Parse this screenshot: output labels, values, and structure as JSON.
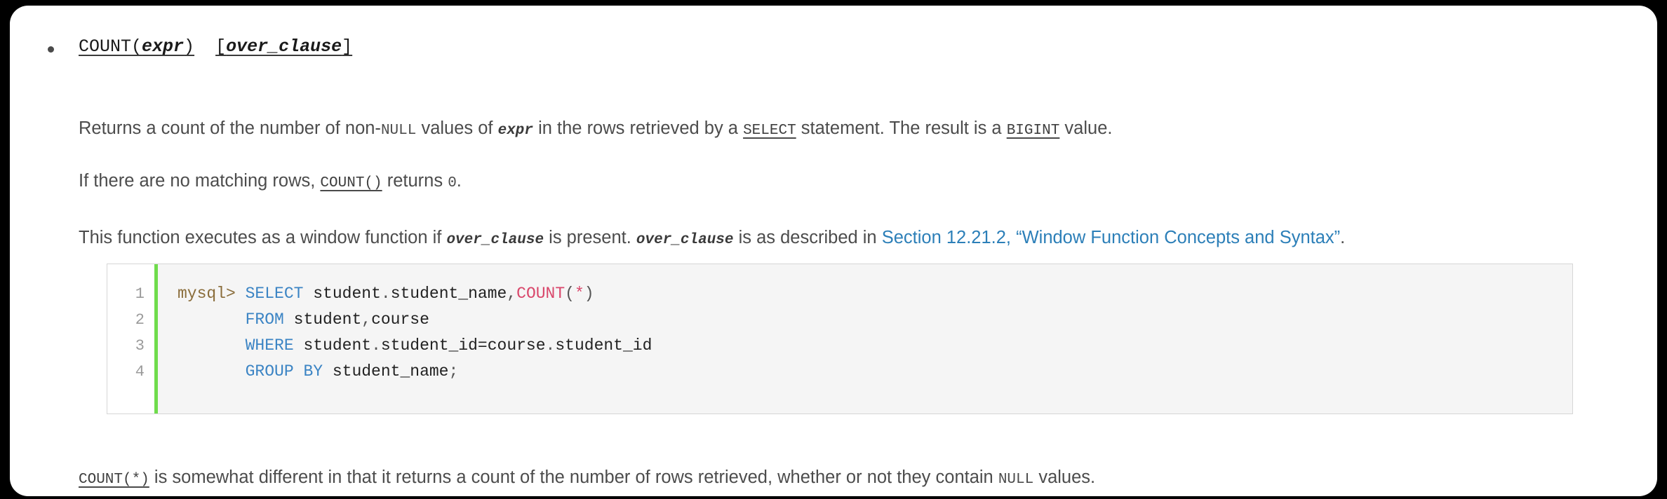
{
  "document": {
    "signature": {
      "fn_name": "COUNT",
      "open_paren": "(",
      "param": "expr",
      "close_paren": ")",
      "space": "  ",
      "bracket_open": "[",
      "over_clause": "over_clause",
      "bracket_close": "]"
    },
    "paragraph1": {
      "part1": "Returns a count of the number of non-",
      "null_kw": "NULL",
      "part2": " values of ",
      "expr": "expr",
      "part3": " in the rows retrieved by a ",
      "select_kw": "SELECT",
      "part4": " statement. The result is a ",
      "bigint_kw": "BIGINT",
      "part5": " value."
    },
    "paragraph2": {
      "part1": "If there are no matching rows, ",
      "count_kw": "COUNT()",
      "part2": " returns ",
      "zero": "0",
      "part3": "."
    },
    "paragraph3": {
      "part1": "This function executes as a window function if ",
      "over_clause_1": "over_clause",
      "part2": " is present. ",
      "over_clause_2": "over_clause",
      "part3": " is as described in ",
      "link": "Section 12.21.2, “Window Function Concepts and Syntax”",
      "part4": "."
    },
    "paragraph4": {
      "count_star": "COUNT(*)",
      "part1": " is somewhat different in that it returns a count of the number of rows retrieved, whether or not they contain ",
      "null_kw": "NULL",
      "part2": " values."
    },
    "code_block": {
      "line_numbers": [
        "1",
        "2",
        "3",
        "4"
      ],
      "lines": [
        {
          "tokens": [
            {
              "text": "mysql> ",
              "type": "prompt"
            },
            {
              "text": "SELECT",
              "type": "kw"
            },
            {
              "text": " student",
              "type": "plain"
            },
            {
              "text": ".",
              "type": "punct"
            },
            {
              "text": "student_name",
              "type": "plain"
            },
            {
              "text": ",",
              "type": "punct"
            },
            {
              "text": "COUNT",
              "type": "fn"
            },
            {
              "text": "(",
              "type": "punct"
            },
            {
              "text": "*",
              "type": "fn"
            },
            {
              "text": ")",
              "type": "punct"
            }
          ]
        },
        {
          "tokens": [
            {
              "text": "       ",
              "type": "plain"
            },
            {
              "text": "FROM",
              "type": "kw"
            },
            {
              "text": " student",
              "type": "plain"
            },
            {
              "text": ",",
              "type": "punct"
            },
            {
              "text": "course",
              "type": "plain"
            }
          ]
        },
        {
          "tokens": [
            {
              "text": "       ",
              "type": "plain"
            },
            {
              "text": "WHERE",
              "type": "kw"
            },
            {
              "text": " student",
              "type": "plain"
            },
            {
              "text": ".",
              "type": "punct"
            },
            {
              "text": "student_id",
              "type": "plain"
            },
            {
              "text": "=",
              "type": "plain"
            },
            {
              "text": "course",
              "type": "plain"
            },
            {
              "text": ".",
              "type": "punct"
            },
            {
              "text": "student_id",
              "type": "plain"
            }
          ]
        },
        {
          "tokens": [
            {
              "text": "       ",
              "type": "plain"
            },
            {
              "text": "GROUP BY",
              "type": "kw"
            },
            {
              "text": " student_name",
              "type": "plain"
            },
            {
              "text": ";",
              "type": "punct"
            }
          ]
        }
      ]
    },
    "colors": {
      "page_background": "#ffffff",
      "outer_background": "#000000",
      "body_text": "#4c4c4c",
      "link": "#2c7fb8",
      "code_background": "#f5f5f5",
      "code_border": "#d6d6d6",
      "gutter_accent": "#6fdc4c",
      "keyword": "#3b84c4",
      "function": "#d9476b",
      "prompt": "#8a6d3b"
    }
  }
}
